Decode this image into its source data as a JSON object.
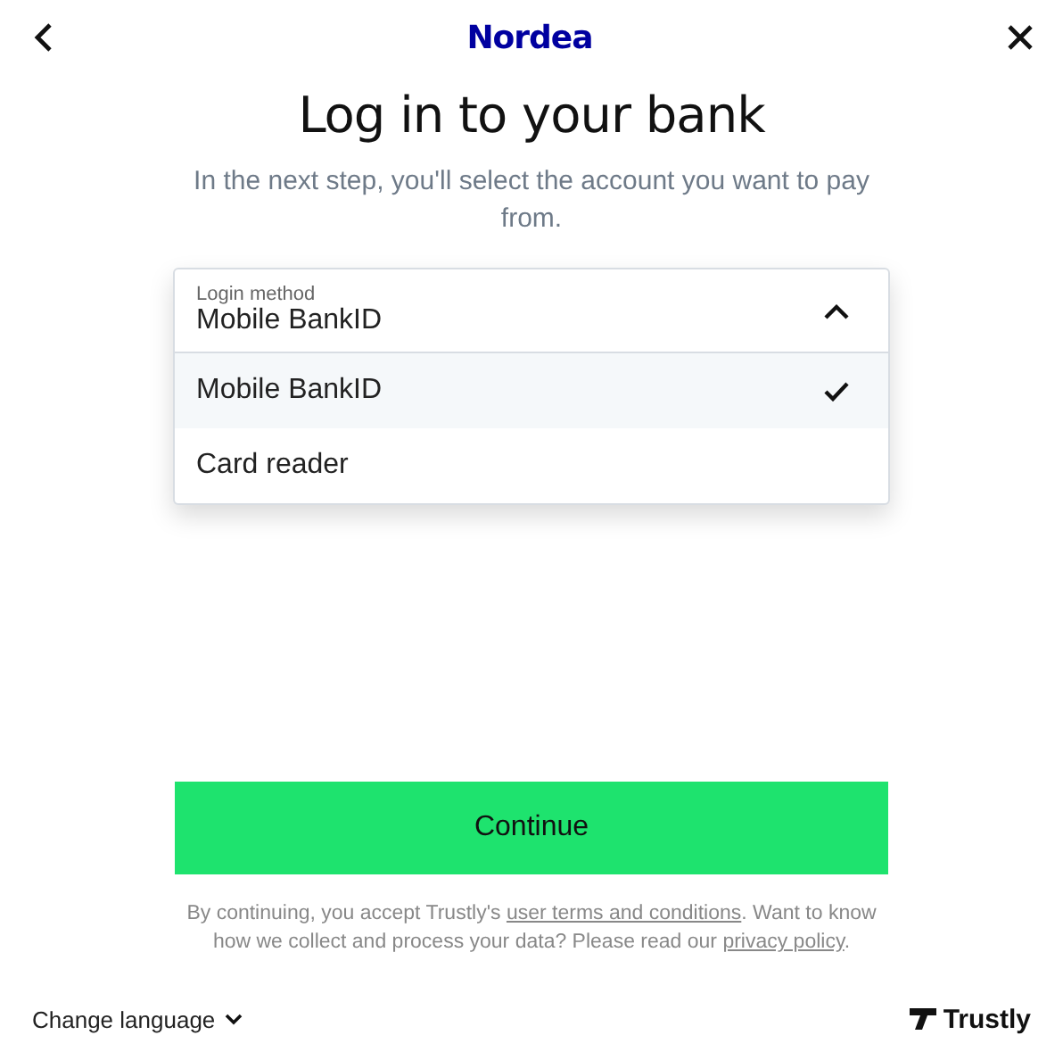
{
  "header": {
    "bank_name": "Nordea"
  },
  "title": "Log in to your bank",
  "subtitle": "In the next step, you'll select the account you want to pay from.",
  "login_method": {
    "label": "Login method",
    "value": "Mobile BankID",
    "expanded": true,
    "options": [
      {
        "label": "Mobile BankID",
        "selected": true
      },
      {
        "label": "Card reader",
        "selected": false
      }
    ]
  },
  "continue_button": "Continue",
  "legal": [
    {
      "kind": "text",
      "text": "By continuing, you accept Trustly's "
    },
    {
      "kind": "link",
      "text": "user terms and conditions"
    },
    {
      "kind": "text",
      "text": ". Want to know how we collect and process your data? Please read our "
    },
    {
      "kind": "link",
      "text": "privacy policy"
    },
    {
      "kind": "text",
      "text": "."
    }
  ],
  "footer": {
    "language_button": "Change language",
    "brand": "Trustly"
  }
}
